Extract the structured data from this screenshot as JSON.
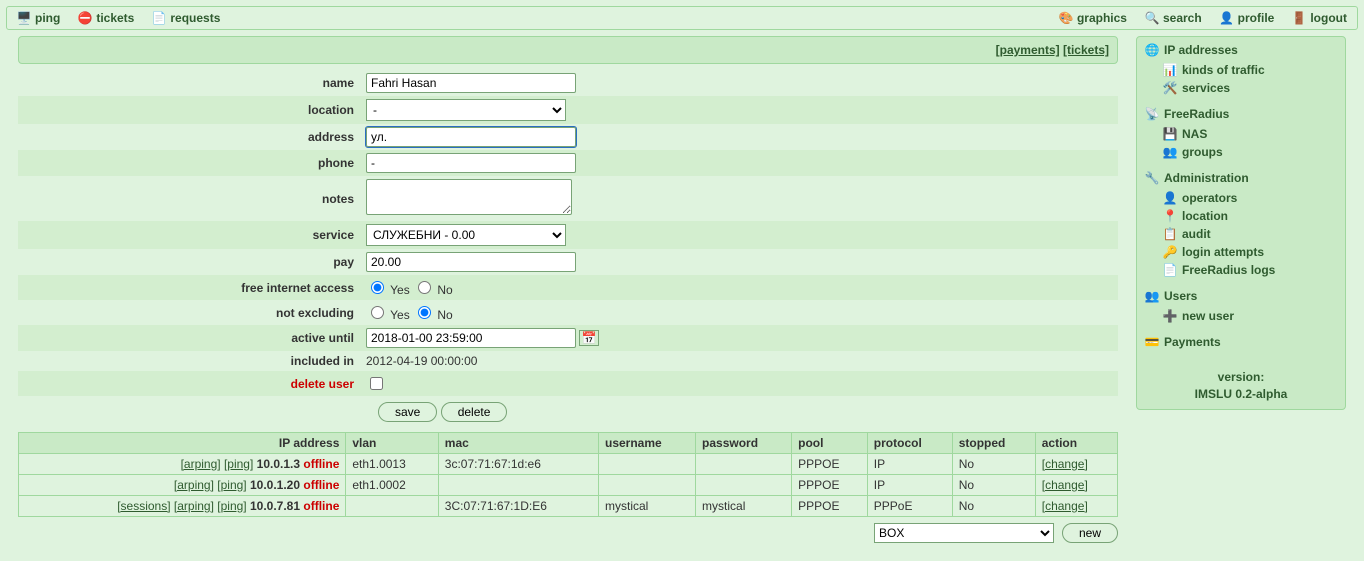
{
  "toolbar": {
    "left": [
      {
        "id": "ping",
        "label": "ping"
      },
      {
        "id": "tickets",
        "label": "tickets"
      },
      {
        "id": "requests",
        "label": "requests"
      }
    ],
    "right": [
      {
        "id": "graphics",
        "label": "graphics"
      },
      {
        "id": "search",
        "label": "search"
      },
      {
        "id": "profile",
        "label": "profile"
      },
      {
        "id": "logout",
        "label": "logout"
      }
    ]
  },
  "toplinks": {
    "payments": "[payments]",
    "tickets": "[tickets]"
  },
  "form": {
    "name_label": "name",
    "name_value": "Fahri Hasan",
    "location_label": "location",
    "location_value": "-",
    "address_label": "address",
    "address_value": "ул.",
    "phone_label": "phone",
    "phone_value": "-",
    "notes_label": "notes",
    "notes_value": "",
    "service_label": "service",
    "service_value": "СЛУЖЕБНИ - 0.00",
    "pay_label": "pay",
    "pay_value": "20.00",
    "fia_label": "free internet access",
    "yes": "Yes",
    "no": "No",
    "nex_label": "not excluding",
    "active_label": "active until",
    "active_value": "2018-01-00 23:59:00",
    "included_label": "included in",
    "included_value": "2012-04-19 00:00:00",
    "delete_user_label": "delete user",
    "save": "save",
    "delete": "delete"
  },
  "iptable": {
    "headers": {
      "ip": "IP address",
      "vlan": "vlan",
      "mac": "mac",
      "username": "username",
      "password": "password",
      "pool": "pool",
      "protocol": "protocol",
      "stopped": "stopped",
      "action": "action"
    },
    "links": {
      "arping": "[arping]",
      "ping": "[ping]",
      "sessions": "[sessions]",
      "change": "[change]"
    },
    "rows": [
      {
        "tools": [
          "arping",
          "ping"
        ],
        "ip": "10.0.1.3",
        "status": "offline",
        "vlan": "eth1.0013",
        "mac": "3c:07:71:67:1d:e6",
        "username": "",
        "password": "",
        "pool": "PPPOE",
        "protocol": "IP",
        "stopped": "No"
      },
      {
        "tools": [
          "arping",
          "ping"
        ],
        "ip": "10.0.1.20",
        "status": "offline",
        "vlan": "eth1.0002",
        "mac": "",
        "username": "",
        "password": "",
        "pool": "PPPOE",
        "protocol": "IP",
        "stopped": "No"
      },
      {
        "tools": [
          "sessions",
          "arping",
          "ping"
        ],
        "ip": "10.0.7.81",
        "status": "offline",
        "vlan": "",
        "mac": "3C:07:71:67:1D:E6",
        "username": "mystical",
        "password": "mystical",
        "pool": "PPPOE",
        "protocol": "PPPoE",
        "stopped": "No"
      }
    ],
    "new_select": "BOX",
    "new_button": "new"
  },
  "sidebar": {
    "groups": [
      {
        "title": "IP addresses",
        "items": [
          "kinds of traffic",
          "services"
        ]
      },
      {
        "title": "FreeRadius",
        "items": [
          "NAS",
          "groups"
        ]
      },
      {
        "title": "Administration",
        "items": [
          "operators",
          "location",
          "audit",
          "login attempts",
          "FreeRadius logs"
        ]
      },
      {
        "title": "Users",
        "items": [
          "new user"
        ]
      },
      {
        "title": "Payments",
        "items": []
      }
    ]
  },
  "version": {
    "line1": "version:",
    "line2": "IMSLU 0.2-alpha"
  }
}
